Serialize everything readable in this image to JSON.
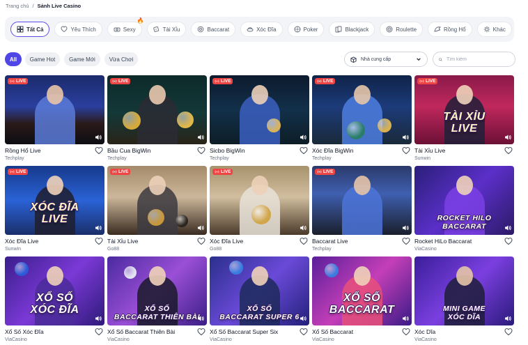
{
  "breadcrumb": {
    "home": "Trang chủ",
    "separator": "/",
    "current": "Sảnh Live Casino"
  },
  "categories": [
    {
      "label": "Tất Cả",
      "icon": "grid-icon"
    },
    {
      "label": "Yêu Thích",
      "icon": "heart-icon"
    },
    {
      "label": "Sexy",
      "icon": "sexy-icon",
      "hot": true
    },
    {
      "label": "Tài Xỉu",
      "icon": "dice-icon"
    },
    {
      "label": "Baccarat",
      "icon": "chip-icon"
    },
    {
      "label": "Xóc Đĩa",
      "icon": "plate-icon"
    },
    {
      "label": "Poker",
      "icon": "poker-icon"
    },
    {
      "label": "Blackjack",
      "icon": "cards-icon"
    },
    {
      "label": "Roulette",
      "icon": "roulette-icon"
    },
    {
      "label": "Rồng Hổ",
      "icon": "dragon-icon"
    },
    {
      "label": "Khác",
      "icon": "gear-icon"
    }
  ],
  "filters": [
    {
      "label": "All"
    },
    {
      "label": "Game Hot"
    },
    {
      "label": "Game Mới"
    },
    {
      "label": "Vừa Chơi"
    }
  ],
  "provider_select": {
    "label": "Nhà cung cấp"
  },
  "search": {
    "placeholder": "Tìm kiếm"
  },
  "live_label": "LIVE",
  "games": [
    {
      "name": "Rồng Hổ Live",
      "provider": "Techplay",
      "live": true,
      "banner": "",
      "theme": "dragon"
    },
    {
      "name": "Bầu Cua BigWin",
      "provider": "Techplay",
      "live": true,
      "banner": "",
      "theme": "baucua"
    },
    {
      "name": "Sicbo BigWin",
      "provider": "Techplay",
      "live": true,
      "banner": "",
      "theme": "sicbo"
    },
    {
      "name": "Xóc Đĩa BigWin",
      "provider": "Techplay",
      "live": true,
      "banner": "",
      "theme": "xocdia"
    },
    {
      "name": "Tài Xỉu Live",
      "provider": "Sunwin",
      "live": true,
      "banner": "TÀI XỈU\nLIVE",
      "theme": "taixiu"
    },
    {
      "name": "Xóc Đĩa Live",
      "provider": "Sunwin",
      "live": true,
      "banner": "XÓC ĐĨA\nLIVE",
      "theme": "xocdialive"
    },
    {
      "name": "Tài Xỉu Live",
      "provider": "Go88",
      "live": true,
      "banner": "",
      "theme": "go88a"
    },
    {
      "name": "Xóc Đĩa Live",
      "provider": "Go88",
      "live": true,
      "banner": "",
      "theme": "go88b"
    },
    {
      "name": "Baccarat Live",
      "provider": "Techplay",
      "live": true,
      "banner": "",
      "theme": "baccarat"
    },
    {
      "name": "Rocket HiLo Baccarat",
      "provider": "ViaCasino",
      "live": false,
      "banner": "ROCKET HILO\nBACCARAT",
      "theme": "rocket"
    },
    {
      "name": "Xổ Số Xóc Đĩa",
      "provider": "ViaCasino",
      "live": false,
      "banner": "XỔ SỐ\nXÓC ĐĨA",
      "theme": "xsxd"
    },
    {
      "name": "Xổ Số Baccarat Thiên Bài",
      "provider": "ViaCasino",
      "live": false,
      "banner": "XỔ SỐ\nBACCARAT THIÊN BÀI",
      "theme": "xsbtb"
    },
    {
      "name": "Xổ Số Baccarat Super Six",
      "provider": "ViaCasino",
      "live": false,
      "banner": "XỔ SỐ\nBACCARAT SUPER 6",
      "theme": "xsbs6"
    },
    {
      "name": "Xổ Số Baccarat",
      "provider": "ViaCasino",
      "live": false,
      "banner": "XỔ SỐ\nBACCARAT",
      "theme": "xsb"
    },
    {
      "name": "Xóc Dĩa",
      "provider": "ViaCasino",
      "live": false,
      "banner": "MINI GAME\nXÓC DĨA",
      "theme": "minigame"
    }
  ],
  "colors": {
    "accent": "#4f46e5",
    "live": "#ef4444",
    "hot": "#f97316"
  }
}
